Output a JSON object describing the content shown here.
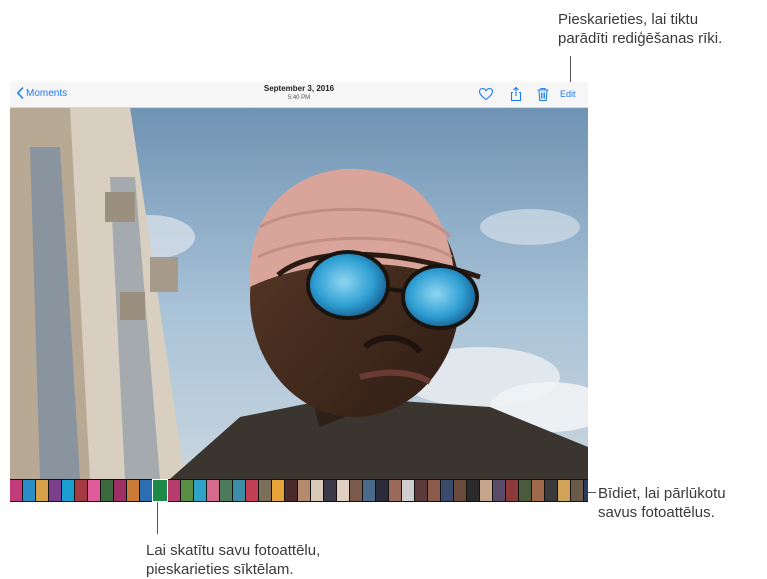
{
  "callouts": {
    "edit": [
      "Pieskarieties, lai tiktu",
      "parādīti rediģēšanas rīki."
    ],
    "browse": [
      "Bīdiet, lai pārlūkotu",
      "savus fotoattēlus."
    ],
    "tap": [
      "Lai skatītu savu fotoattēlu,",
      "pieskarieties sīktēlam."
    ]
  },
  "toolbar": {
    "back_label": "Moments",
    "date": "September 3, 2016",
    "time": "5:40 PM",
    "edit_label": "Edit",
    "accent": "#1e7cf2"
  },
  "icons": [
    "chevron-left-icon",
    "heart-icon",
    "share-icon",
    "trash-icon"
  ],
  "thumbnails": {
    "selected_index": 11,
    "colors": [
      "#c33b7a",
      "#2a8ec9",
      "#d7a04a",
      "#7b3f8c",
      "#1b9fd1",
      "#a33a44",
      "#e05b9c",
      "#3c6a3e",
      "#9c2f63",
      "#cc7a3a",
      "#2b6fb0",
      "#1e8a4a",
      "#b63c6d",
      "#5a8e45",
      "#2ea3c7",
      "#d56b8c",
      "#4b7b5b",
      "#3c8da8",
      "#c13f52",
      "#7c6f59",
      "#e6a43a",
      "#4a2a2a",
      "#b58a6e",
      "#d8c9b8",
      "#3a3a4a",
      "#e0cfc2",
      "#7a5a4a",
      "#4b6a8a",
      "#2b2b3a",
      "#9a6a5a",
      "#cfcfcf",
      "#5a3a3a",
      "#8a5a4a",
      "#3a4a6a",
      "#6a4a3a",
      "#2a2a2a",
      "#c7a58a",
      "#5a4a6a",
      "#8b3a3a",
      "#4a5a3a",
      "#a06a4a",
      "#3a3a3a",
      "#cfa35a",
      "#6a5a4a",
      "#2a3a5a",
      "#9a7a5a",
      "#d4b04a",
      "#5a4a3a",
      "#3a2a2a",
      "#7a6a5a",
      "#bfa07a",
      "#4a3a4a",
      "#8a7a6a",
      "#b59a7a"
    ]
  }
}
